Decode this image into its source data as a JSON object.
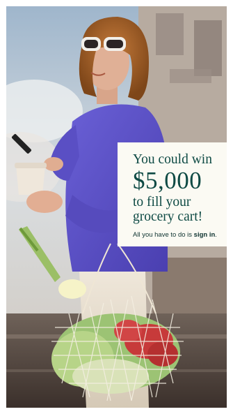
{
  "promo": {
    "line1": "You could win",
    "amount": "$5,000",
    "line2": "to fill your",
    "line3": "grocery cart!",
    "cta_prefix": "All you have to do is ",
    "cta_link": "sign in",
    "cta_suffix": "."
  },
  "colors": {
    "panel_bg": "#fbfaf3",
    "headline": "#0e4a44",
    "sweater": "#5a4fc4"
  }
}
